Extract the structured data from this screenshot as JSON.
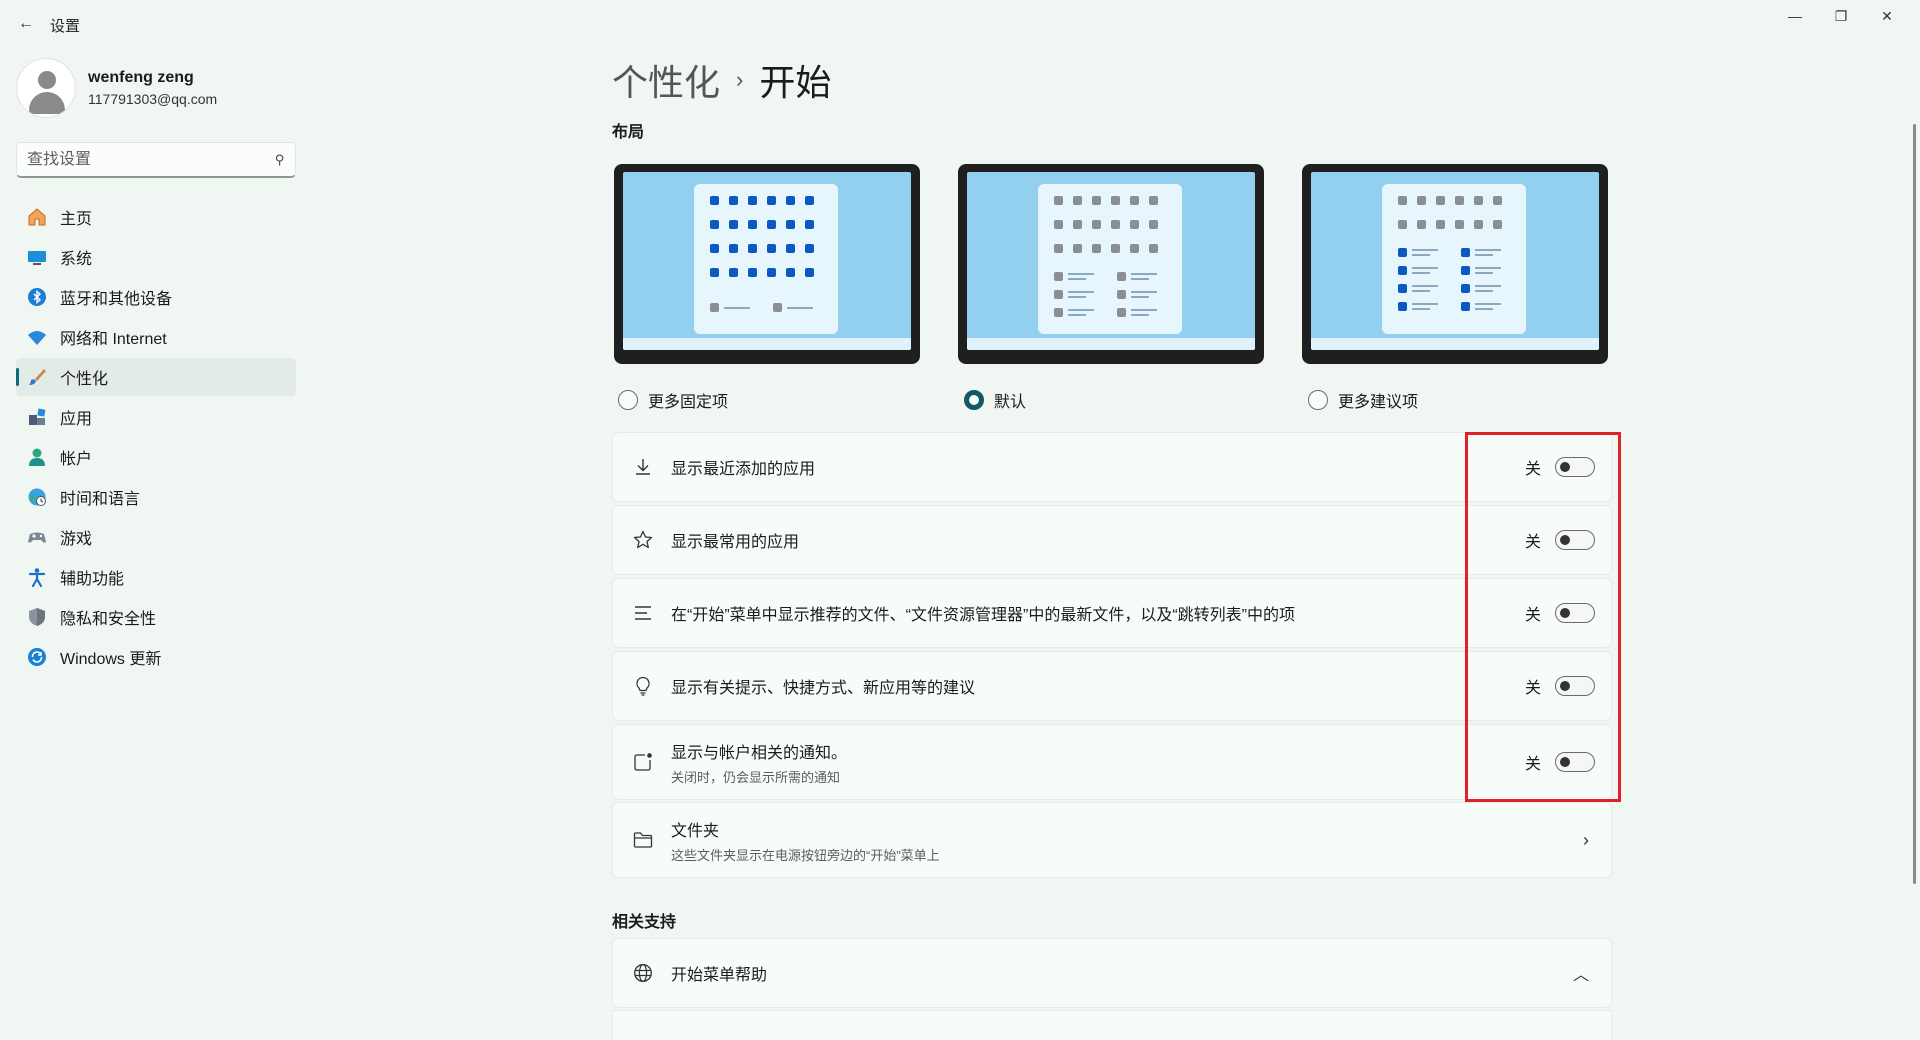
{
  "window": {
    "title": "设置",
    "back_icon": "back-arrow-icon",
    "min_symbol": "—",
    "max_symbol": "❐",
    "close_symbol": "✕"
  },
  "user": {
    "name": "wenfeng zeng",
    "email": "117791303@qq.com"
  },
  "search": {
    "placeholder": "查找设置",
    "icon": "search-icon"
  },
  "nav": {
    "items": [
      {
        "label": "主页",
        "icon": "home-icon",
        "active": false
      },
      {
        "label": "系统",
        "icon": "system-monitor-icon",
        "active": false
      },
      {
        "label": "蓝牙和其他设备",
        "icon": "bluetooth-icon",
        "active": false
      },
      {
        "label": "网络和 Internet",
        "icon": "wifi-icon",
        "active": false
      },
      {
        "label": "个性化",
        "icon": "brush-icon",
        "active": true
      },
      {
        "label": "应用",
        "icon": "apps-icon",
        "active": false
      },
      {
        "label": "帐户",
        "icon": "account-icon",
        "active": false
      },
      {
        "label": "时间和语言",
        "icon": "globe-clock-icon",
        "active": false
      },
      {
        "label": "游戏",
        "icon": "gamepad-icon",
        "active": false
      },
      {
        "label": "辅助功能",
        "icon": "accessibility-icon",
        "active": false
      },
      {
        "label": "隐私和安全性",
        "icon": "shield-icon",
        "active": false
      },
      {
        "label": "Windows 更新",
        "icon": "update-icon",
        "active": false
      }
    ]
  },
  "breadcrumb": {
    "parent": "个性化",
    "separator": "›",
    "current": "开始"
  },
  "layout": {
    "title": "布局",
    "options": [
      {
        "label": "更多固定项",
        "selected": false
      },
      {
        "label": "默认",
        "selected": true
      },
      {
        "label": "更多建议项",
        "selected": false
      }
    ]
  },
  "settings": [
    {
      "label": "显示最近添加的应用",
      "sub": "",
      "icon": "download-icon",
      "state": "关"
    },
    {
      "label": "显示最常用的应用",
      "sub": "",
      "icon": "star-icon",
      "state": "关"
    },
    {
      "label": "在“开始”菜单中显示推荐的文件、“文件资源管理器”中的最新文件，以及“跳转列表”中的项",
      "sub": "",
      "icon": "list-lines-icon",
      "state": "关"
    },
    {
      "label": "显示有关提示、快捷方式、新应用等的建议",
      "sub": "",
      "icon": "lightbulb-icon",
      "state": "关"
    },
    {
      "label": "显示与帐户相关的通知。",
      "sub": "关闭时，仍会显示所需的通知",
      "icon": "notification-badge-icon",
      "state": "关"
    }
  ],
  "folders": {
    "label": "文件夹",
    "sub": "这些文件夹显示在电源按钮旁边的“开始”菜单上",
    "icon": "folder-icon"
  },
  "related": {
    "title": "相关支持",
    "help_label": "开始菜单帮助",
    "help_icon": "globe-icon"
  },
  "colors": {
    "accent": "#0f5a66",
    "highlight": "#e0212b",
    "background": "#f0f7f2"
  }
}
